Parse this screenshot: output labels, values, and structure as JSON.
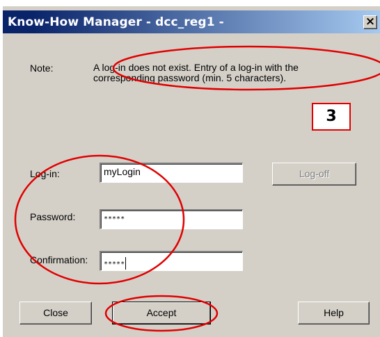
{
  "window": {
    "title": "Know-How Manager - dcc_reg1 -",
    "close_glyph": "×"
  },
  "note": {
    "label": "Note:",
    "text": "A log-in does not exist. Entry of a log-in with the corresponding password (min. 5 characters)."
  },
  "step_marker": "3",
  "form": {
    "login_label": "Log-in:",
    "login_value": "myLogin",
    "password_label": "Password:",
    "password_value": "*****",
    "confirmation_label": "Confirmation:",
    "confirmation_value": "*****"
  },
  "buttons": {
    "logoff": "Log-off",
    "close": "Close",
    "accept": "Accept",
    "help": "Help"
  },
  "colors": {
    "dialog_bg": "#d4d0c8",
    "titlebar_start": "#0a246a",
    "titlebar_end": "#a6caf0",
    "annotation_red": "#e00000"
  }
}
